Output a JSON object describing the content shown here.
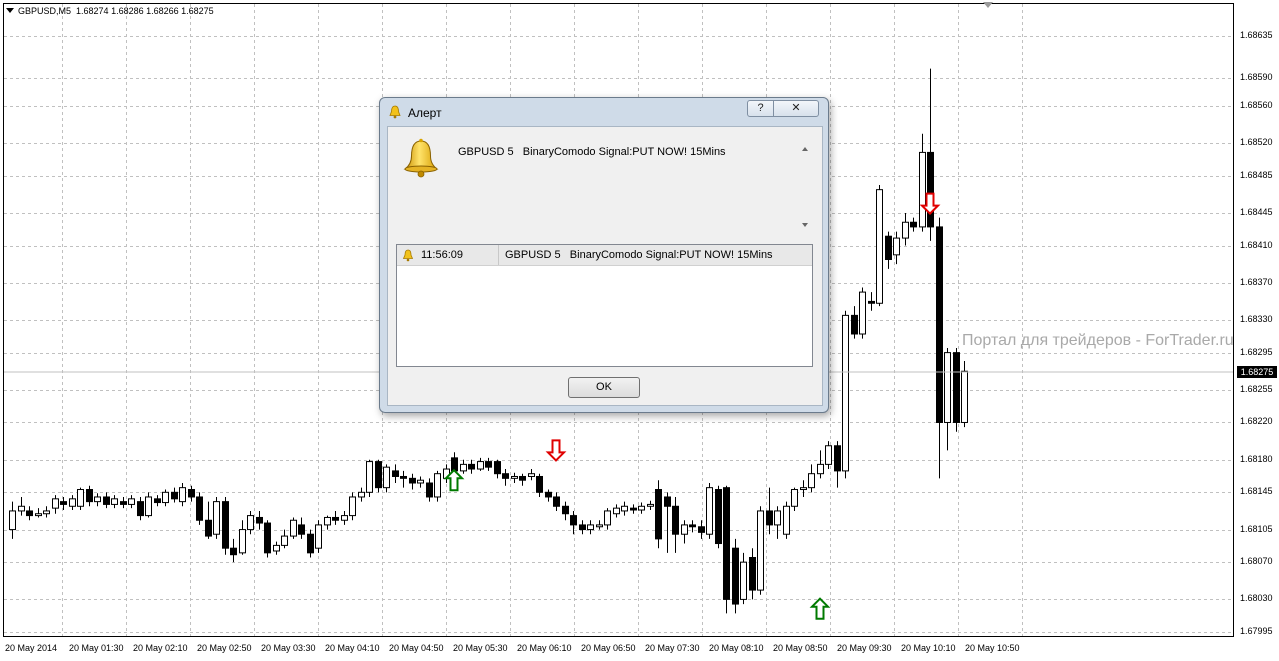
{
  "chart": {
    "symbol": "GBPUSD,M5",
    "ohlc": "1.68274 1.68286 1.68266 1.68275",
    "current_price": "1.68275",
    "watermark": "Портал для трейдеров - ForTrader.ru",
    "price_axis": [
      "1.68635",
      "1.68590",
      "1.68560",
      "1.68520",
      "1.68485",
      "1.68445",
      "1.68410",
      "1.68370",
      "1.68330",
      "1.68295",
      "1.68255",
      "1.68220",
      "1.68180",
      "1.68145",
      "1.68105",
      "1.68070",
      "1.68030",
      "1.67995"
    ],
    "time_axis": [
      "20 May 2014",
      "20 May 01:30",
      "20 May 02:10",
      "20 May 02:50",
      "20 May 03:30",
      "20 May 04:10",
      "20 May 04:50",
      "20 May 05:30",
      "20 May 06:10",
      "20 May 06:50",
      "20 May 07:30",
      "20 May 08:10",
      "20 May 08:50",
      "20 May 09:30",
      "20 May 10:10",
      "20 May 10:50"
    ],
    "colors": {
      "up_arrow": "#007a00",
      "down_arrow": "#e00000",
      "grid": "#c0c0c0",
      "bear": "#000000",
      "bull": "#ffffff"
    }
  },
  "dialog": {
    "title": "Алерт",
    "help_label": "?",
    "close_label": "✕",
    "icon": "bell-icon",
    "message": "GBPUSD 5   BinaryComodo Signal:PUT NOW! 15Mins",
    "log": [
      {
        "time": "11:56:09",
        "message": "GBPUSD 5   BinaryComodo Signal:PUT NOW! 15Mins"
      }
    ],
    "ok_label": "OK"
  }
}
